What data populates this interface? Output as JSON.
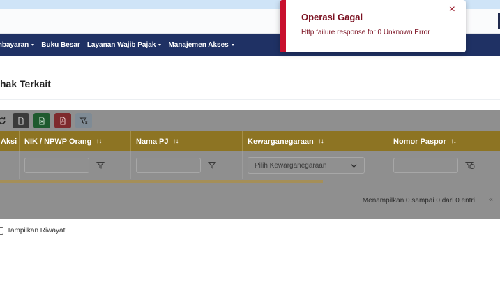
{
  "navbar": {
    "items": [
      {
        "label": "mbayaran",
        "dropdown": true
      },
      {
        "label": "Buku Besar",
        "dropdown": false
      },
      {
        "label": "Layanan Wajib Pajak",
        "dropdown": true
      },
      {
        "label": "Manajemen Akses",
        "dropdown": true
      }
    ]
  },
  "page": {
    "title": "hak Terkait"
  },
  "toolbar": {
    "buttons": [
      {
        "icon": "refresh-icon"
      },
      {
        "icon": "document-icon"
      },
      {
        "icon": "excel-icon"
      },
      {
        "icon": "pdf-icon"
      },
      {
        "icon": "clear-filter-icon"
      }
    ]
  },
  "table": {
    "columns": [
      {
        "label": "Aksi",
        "sortable": false
      },
      {
        "label": "NIK / NPWP Orang",
        "sortable": true
      },
      {
        "label": "Nama PJ",
        "sortable": true
      },
      {
        "label": "Kewarganegaraan",
        "sortable": true
      },
      {
        "label": "Nomor Paspor",
        "sortable": true
      }
    ],
    "sort_glyph": "↑↓",
    "filters": {
      "nik_value": "",
      "nama_value": "",
      "kewarganegaraan_placeholder": "Pilih Kewarganegaraan",
      "paspor_value": ""
    },
    "footer_info": "Menampilkan 0 sampai 0 dari 0 entri",
    "pager_prev": "«"
  },
  "riwayat": {
    "label": "Tampilkan Riwayat",
    "checked": false
  },
  "toast": {
    "title": "Operasi Gagal",
    "message": "Http failure response for 0 Unknown Error",
    "close": "×"
  },
  "colors": {
    "navbar": "#1f3164",
    "table_header": "#8d7423",
    "toast_accent": "#c8102e"
  }
}
